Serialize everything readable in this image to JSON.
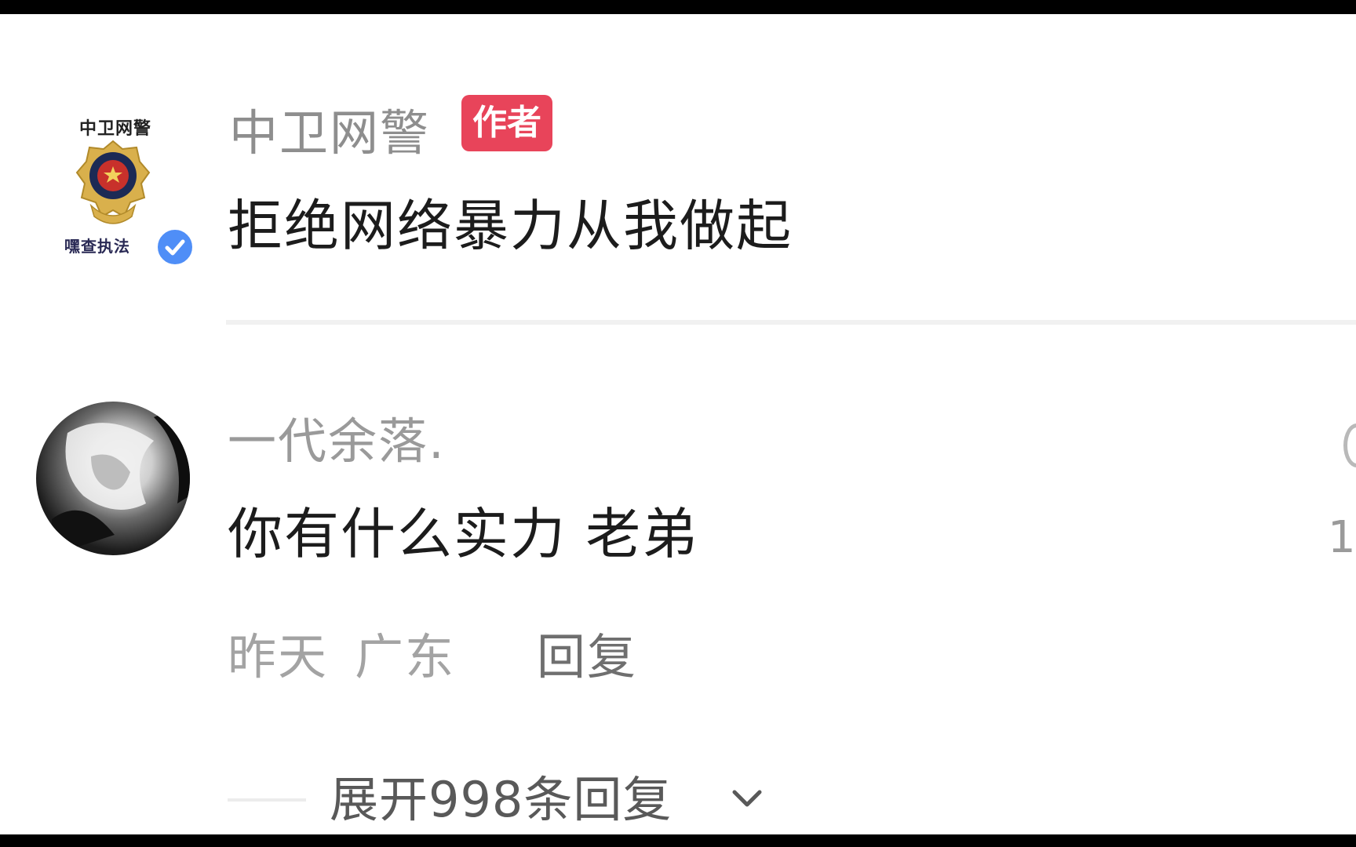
{
  "author_comment": {
    "username": "中卫网警",
    "tag": "作者",
    "text": "拒绝网络暴力从我做起",
    "avatar": {
      "logo_text_top": "中卫网警",
      "logo_text_bottom": "嘿查执法",
      "icon": "police-emblem-icon",
      "verified_icon": "verified-check-icon"
    }
  },
  "reply_comment": {
    "username": "一代余落.",
    "text": "你有什么实力 老弟",
    "time": "昨天",
    "location": "广东",
    "reply_label": "回复",
    "side_count": "1",
    "side_icon": "like-icon"
  },
  "expand": {
    "label": "展开998条回复",
    "icon": "chevron-down-icon"
  },
  "colors": {
    "tag_background": "#e8445a",
    "verified_badge": "#4f8ef7",
    "text_primary": "#1c1c1c",
    "text_secondary": "#9a9a9a"
  }
}
